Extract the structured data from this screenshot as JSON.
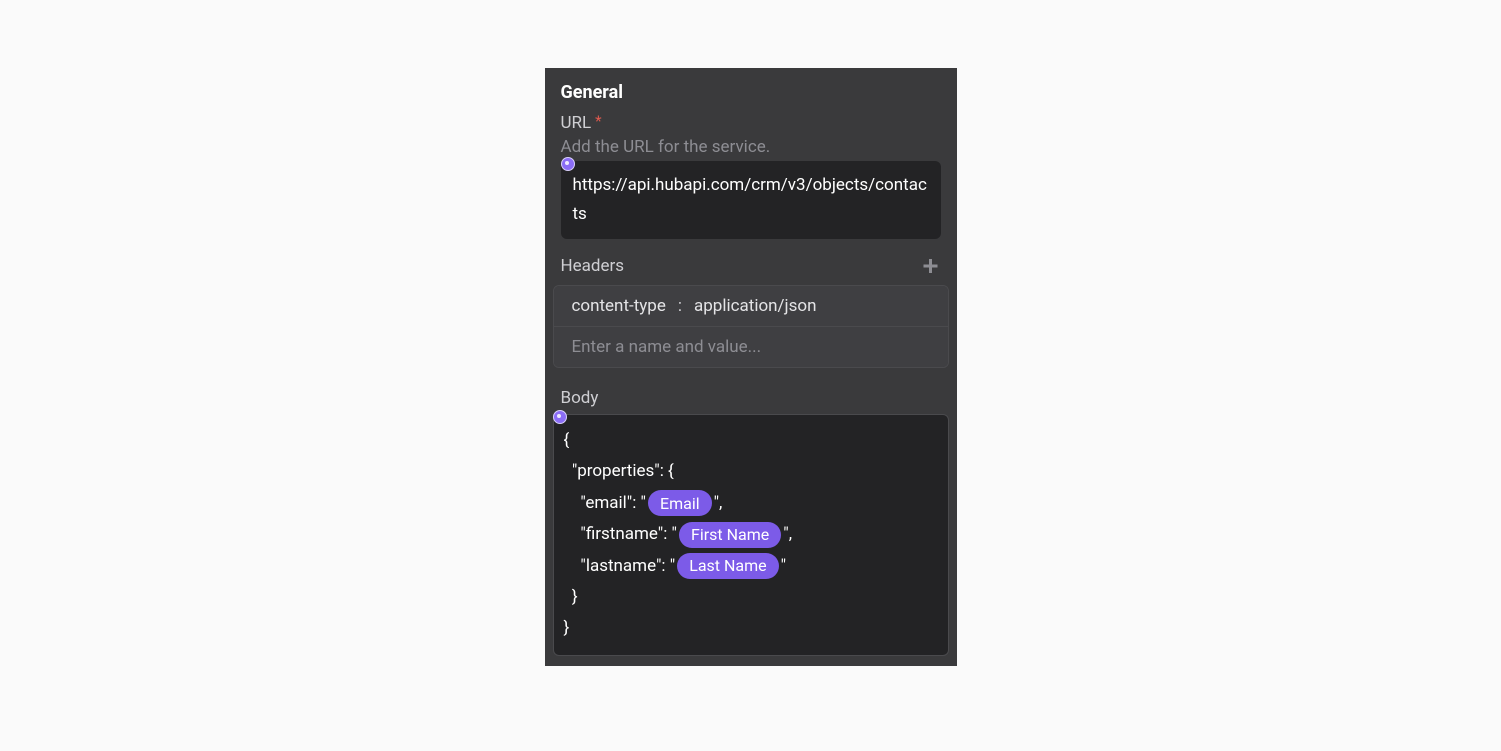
{
  "section_title": "General",
  "url": {
    "label": "URL",
    "required_mark": "*",
    "description": "Add the URL for the service.",
    "value": "https://api.hubapi.com/crm/v3/objects/contacts"
  },
  "headers": {
    "label": "Headers",
    "rows": [
      {
        "name": "content-type",
        "sep": ":",
        "value": "application/json"
      }
    ],
    "empty_placeholder": "Enter a name and value..."
  },
  "body": {
    "label": "Body",
    "open_brace": "{",
    "prop_open": "  \"properties\": {",
    "line_email_pre": "    \"email\": \"",
    "chip_email": "Email",
    "line_email_post": "\",",
    "line_first_pre": "    \"firstname\": \"",
    "chip_first": "First Name",
    "line_first_post": "\",",
    "line_last_pre": "    \"lastname\": \"",
    "chip_last": "Last Name",
    "line_last_post": "\"",
    "prop_close": "  }",
    "close_brace": "}"
  }
}
